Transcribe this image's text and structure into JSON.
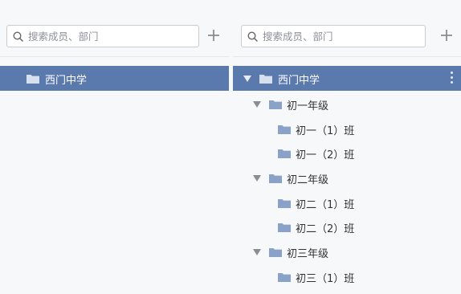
{
  "colors": {
    "selected_bg": "#5a79ad",
    "folder": "#8aa2c8",
    "folder_selected": "#d7e0ee"
  },
  "left_panel": {
    "search_placeholder": "搜索成员、部门",
    "root": {
      "label": "西门中学"
    }
  },
  "right_panel": {
    "search_placeholder": "搜索成员、部门",
    "root": {
      "label": "西门中学"
    },
    "groups": [
      {
        "label": "初一年级",
        "classes": [
          {
            "label": "初一（1）班"
          },
          {
            "label": "初一（2）班"
          }
        ]
      },
      {
        "label": "初二年级",
        "classes": [
          {
            "label": "初二（1）班"
          },
          {
            "label": "初二（2）班"
          }
        ]
      },
      {
        "label": "初三年级",
        "classes": [
          {
            "label": "初三（1）班"
          }
        ]
      }
    ]
  }
}
